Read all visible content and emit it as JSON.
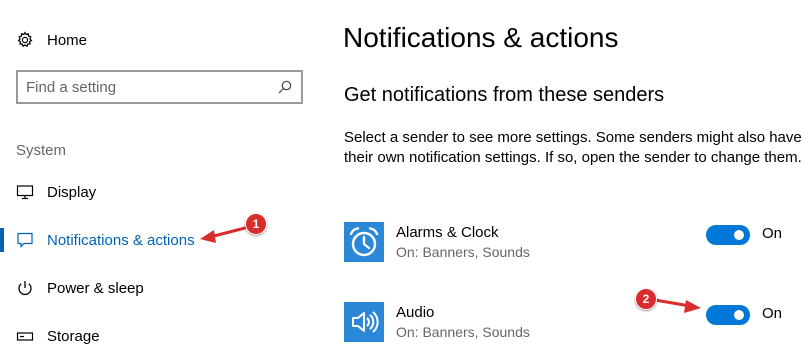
{
  "sidebar": {
    "home_label": "Home",
    "search_placeholder": "Find a setting",
    "section_label": "System",
    "items": [
      {
        "label": "Display",
        "icon": "monitor-icon"
      },
      {
        "label": "Notifications & actions",
        "icon": "notification-icon",
        "active": true
      },
      {
        "label": "Power & sleep",
        "icon": "power-icon"
      },
      {
        "label": "Storage",
        "icon": "storage-icon"
      }
    ]
  },
  "main": {
    "title": "Notifications & actions",
    "section_heading": "Get notifications from these senders",
    "description": "Select a sender to see more settings. Some senders might also have their own notification settings. If so, open the sender to change them.",
    "senders": [
      {
        "name": "Alarms & Clock",
        "subtitle": "On: Banners, Sounds",
        "toggle_label": "On",
        "toggle_on": true,
        "icon": "alarm-clock-icon"
      },
      {
        "name": "Audio",
        "subtitle": "On: Banners, Sounds",
        "toggle_label": "On",
        "toggle_on": true,
        "icon": "speaker-icon"
      }
    ]
  },
  "annotations": {
    "callout_1": "1",
    "callout_2": "2"
  },
  "colors": {
    "accent": "#0063b1",
    "toggle_on": "#0078d7",
    "app_tile": "#2b88d8",
    "callout": "#d92d2d"
  }
}
